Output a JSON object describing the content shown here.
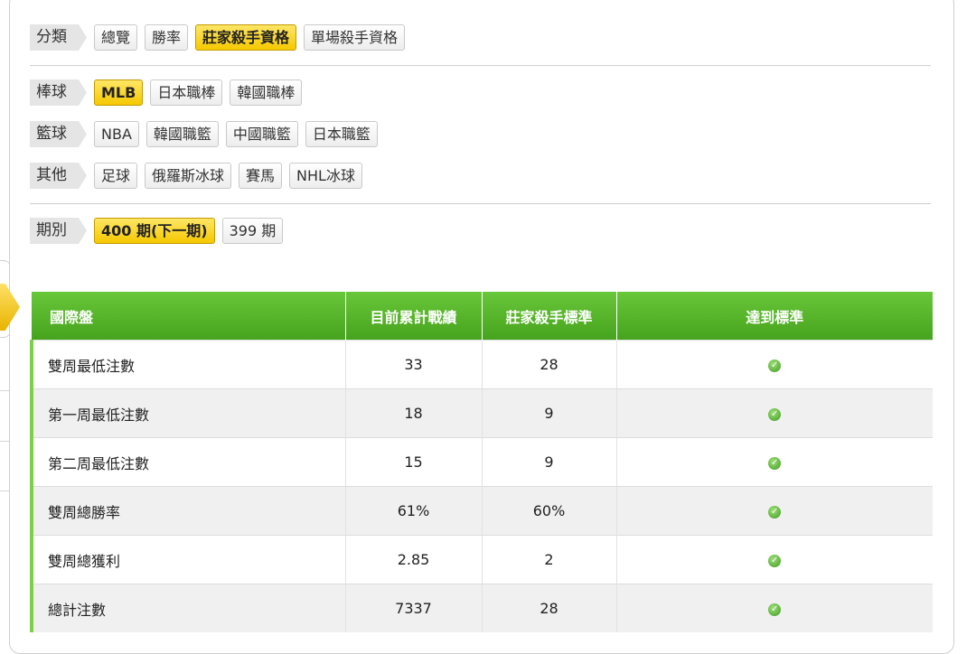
{
  "categories": {
    "label": "分類",
    "tabs": [
      "總覽",
      "勝率",
      "莊家殺手資格",
      "單場殺手資格"
    ],
    "active_tab": "莊家殺手資格"
  },
  "sports": [
    {
      "label": "棒球",
      "items": [
        "MLB",
        "日本職棒",
        "韓國職棒"
      ],
      "active": "MLB"
    },
    {
      "label": "籃球",
      "items": [
        "NBA",
        "韓國職籃",
        "中國職籃",
        "日本職籃"
      ]
    },
    {
      "label": "其他",
      "items": [
        "足球",
        "俄羅斯冰球",
        "賽馬",
        "NHL冰球"
      ]
    }
  ],
  "period": {
    "label": "期別",
    "items": [
      "400 期(下一期)",
      "399 期"
    ],
    "active": "400 期(下一期)"
  },
  "table": {
    "headers": [
      "國際盤",
      "目前累計戰績",
      "莊家殺手標準",
      "達到標準"
    ],
    "rows": [
      {
        "name": "雙周最低注數",
        "current": "33",
        "standard": "28",
        "met": true
      },
      {
        "name": "第一周最低注數",
        "current": "18",
        "standard": "9",
        "met": true
      },
      {
        "name": "第二周最低注數",
        "current": "15",
        "standard": "9",
        "met": true
      },
      {
        "name": "雙周總勝率",
        "current": "61%",
        "standard": "60%",
        "met": true
      },
      {
        "name": "雙周總獲利",
        "current": "2.85",
        "standard": "2",
        "met": true
      },
      {
        "name": "總計注數",
        "current": "7337",
        "standard": "28",
        "met": true
      }
    ]
  },
  "colors": {
    "accent_yellow": "#f5c800",
    "header_green": "#46a31d",
    "row_marker_green": "#7ecf4c"
  }
}
